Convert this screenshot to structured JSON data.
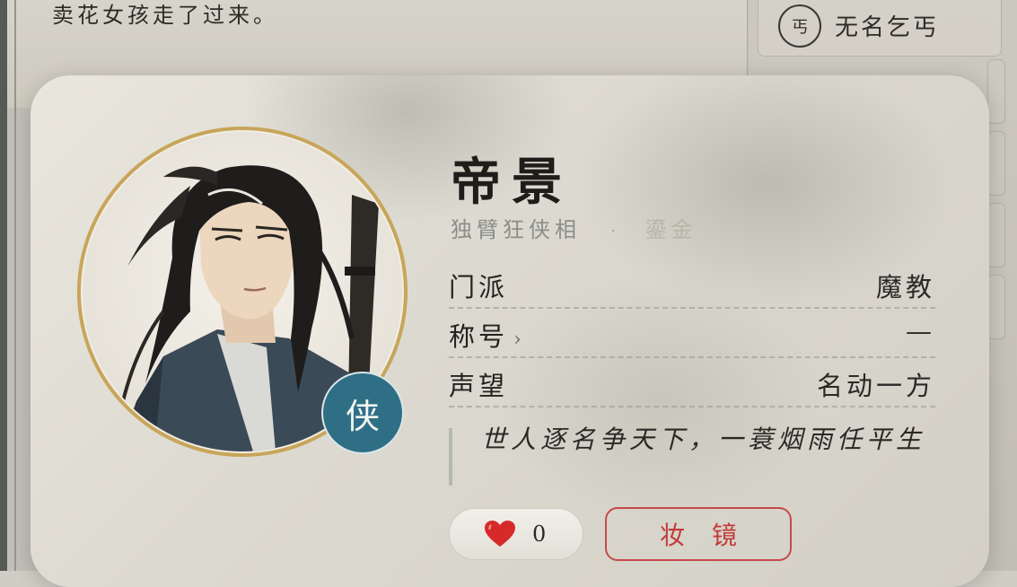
{
  "background": {
    "story_text": "卖花女孩走了过来。",
    "side_list": [
      {
        "icon_char": "丐",
        "name": "无名乞丐"
      }
    ]
  },
  "profile": {
    "name": "帝景",
    "title_tag": "独臂狂侠相",
    "separator": "·",
    "rarity": "鎏金",
    "badge_char": "侠",
    "rows": [
      {
        "label": "门派",
        "value": "魔教",
        "has_arrow": false
      },
      {
        "label": "称号",
        "value": "—",
        "has_arrow": true
      },
      {
        "label": "声望",
        "value": "名动一方",
        "has_arrow": false
      }
    ],
    "arrow": "›",
    "motto": "世人逐名争天下，一蓑烟雨任平生",
    "likes": "0",
    "mirror_button": "妆镜"
  },
  "colors": {
    "badge": "#2f6f86",
    "ring": "#c8a55a",
    "heart": "#d62a2a",
    "mirror": "#c23b3b"
  },
  "icons": {
    "like": "heart-icon",
    "portrait": "portrait-image"
  }
}
